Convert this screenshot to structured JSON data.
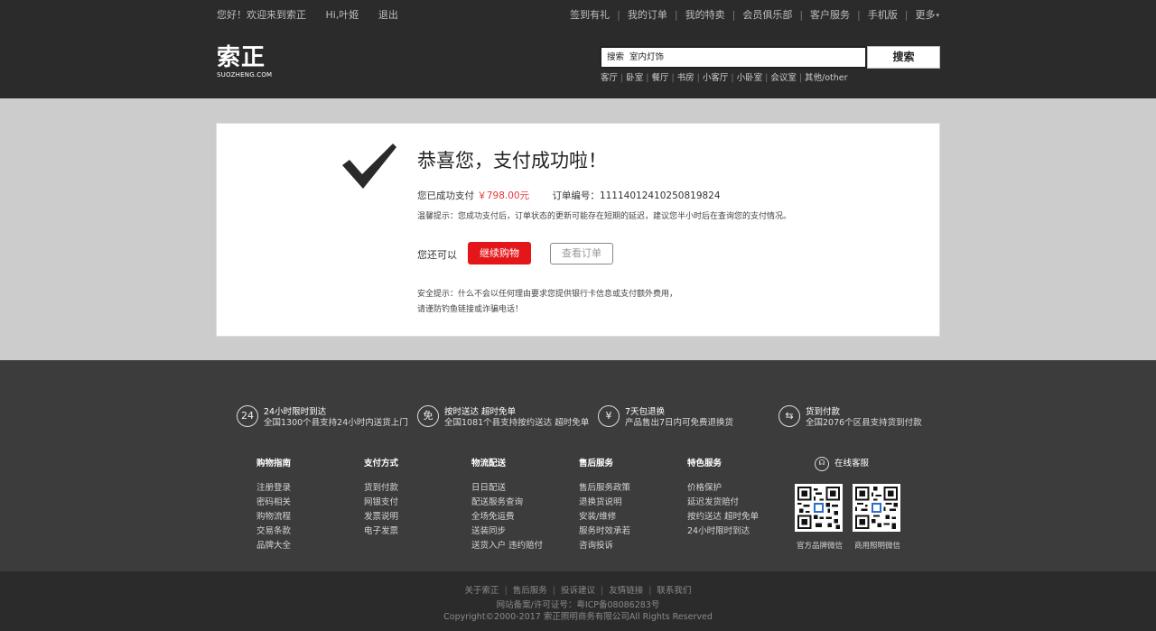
{
  "topbar": {
    "welcome": "您好！欢迎来到索正",
    "user": "Hi,叶姬",
    "logout": "退出",
    "links": [
      "签到有礼",
      "我的订单",
      "我的特卖",
      "会员俱乐部",
      "客户服务",
      "手机版",
      "更多"
    ]
  },
  "logo": {
    "cn": "索正",
    "en": "SUOZHENG.COM"
  },
  "search": {
    "label": "搜索",
    "value": "室内灯饰",
    "button": "搜索",
    "hotwords": [
      "客厅",
      "卧室",
      "餐厅",
      "书房",
      "小客厅",
      "小卧室",
      "会议室",
      "其他/other"
    ]
  },
  "result": {
    "title": "恭喜您，支付成功啦！",
    "paid_prefix": "您已成功支付",
    "amount": "￥798.00元",
    "order_label": "订单编号：",
    "order_no": "11114012410250819824",
    "tip": "温馨提示：您成功支付后，订单状态的更新可能存在短期的延迟，建议您半小时后在查询您的支付情况。",
    "also": "您还可以",
    "continue_btn": "继续购物",
    "view_btn": "查看订单",
    "safe1": "安全提示：什么不会以任何理由要求您提供银行卡信息或支付额外费用，",
    "safe2": "请谨防钓鱼链接或诈骗电话！"
  },
  "promises": [
    {
      "icon": "24",
      "t1": "24小时限时到达",
      "t2": "全国1300个县支持24小时内送货上门"
    },
    {
      "icon": "免",
      "t1": "按时送达 超时免单",
      "t2": "全国1081个县支持按约送达 超时免单"
    },
    {
      "icon": "¥",
      "t1": "7天包退换",
      "t2": "产品售出7日内可免费退换货"
    },
    {
      "icon": "⇆",
      "t1": "货到付款",
      "t2": "全国2076个区县支持货到付款"
    }
  ],
  "footer_cols": [
    {
      "title": "购物指南",
      "links": [
        "注册登录",
        "密码相关",
        "购物流程",
        "交易条款",
        "品牌大全"
      ]
    },
    {
      "title": "支付方式",
      "links": [
        "货到付款",
        "网银支付",
        "发票说明",
        "电子发票"
      ]
    },
    {
      "title": "物流配送",
      "links": [
        "日日配送",
        "配送服务查询",
        "全场免运费",
        "送装同步",
        "送货入户 违约赔付"
      ]
    },
    {
      "title": "售后服务",
      "links": [
        "售后服务政策",
        "退换货说明",
        "安装/维修",
        "服务时效承若",
        "咨询投诉"
      ]
    },
    {
      "title": "特色服务",
      "links": [
        "价格保护",
        "延迟发货赔付",
        "按约送达 超时免单",
        "24小时限时到达"
      ]
    }
  ],
  "service": {
    "label": "在线客服",
    "qr1": "官方品牌微信",
    "qr2": "商用照明微信"
  },
  "bottom": {
    "links": [
      "关于索正",
      "售后服务",
      "投诉建议",
      "友情链接",
      "联系我们"
    ],
    "icp": "网站备案/许可证号：粤ICP备08086283号",
    "copyright": "Copyright©2000-2017 索正照明商务有限公司All Rights Reserved"
  }
}
